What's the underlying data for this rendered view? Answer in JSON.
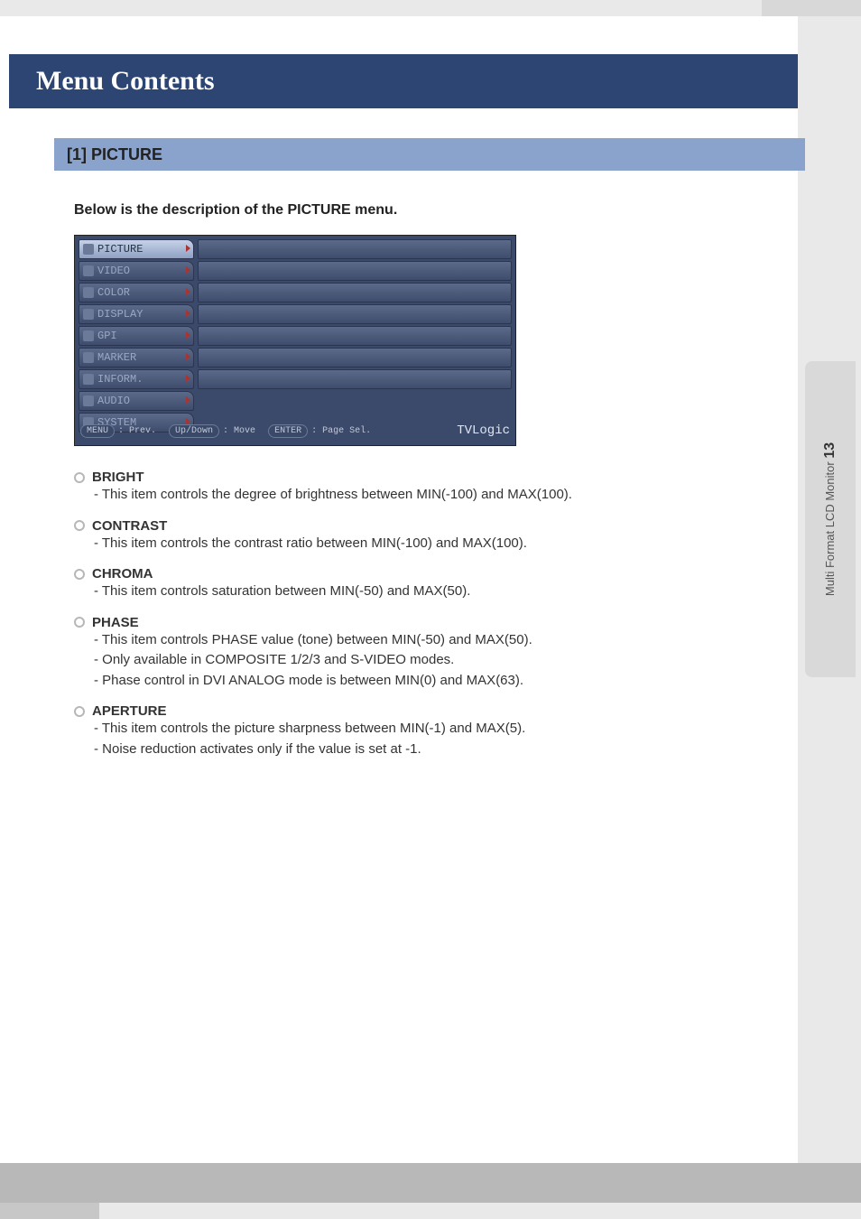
{
  "header": {
    "title": "Menu Contents"
  },
  "section": {
    "label": "[1] PICTURE"
  },
  "intro": "Below is the description of the PICTURE menu.",
  "osd": {
    "tabs": [
      "PICTURE",
      "VIDEO",
      "COLOR",
      "DISPLAY",
      "GPI",
      "MARKER",
      "INFORM.",
      "AUDIO",
      "SYSTEM"
    ],
    "active_index": 0,
    "footer": {
      "menu_key": "MENU",
      "menu_label": ": Prev.",
      "updown_key": "Up/Down",
      "updown_label": ": Move",
      "enter_key": "ENTER",
      "enter_label": ": Page Sel.",
      "brand": "TVLogic"
    }
  },
  "items": [
    {
      "title": "BRIGHT",
      "lines": [
        "- This item controls the degree of brightness between MIN(-100) and MAX(100)."
      ]
    },
    {
      "title": "CONTRAST",
      "lines": [
        "- This item controls the contrast ratio between MIN(-100) and MAX(100)."
      ]
    },
    {
      "title": "CHROMA",
      "lines": [
        "- This item controls saturation between MIN(-50) and MAX(50)."
      ]
    },
    {
      "title": "PHASE",
      "lines": [
        "- This item controls PHASE value (tone) between MIN(-50) and MAX(50).",
        "- Only available in COMPOSITE 1/2/3 and S-VIDEO modes.",
        "- Phase control in DVI ANALOG mode is between MIN(0) and MAX(63)."
      ]
    },
    {
      "title": "APERTURE",
      "lines": [
        "- This item controls the picture sharpness between MIN(-1) and MAX(5).",
        "- Noise reduction activates only if the value is set at -1."
      ]
    }
  ],
  "side": {
    "text": "Multi Format LCD Monitor",
    "page": "13"
  }
}
